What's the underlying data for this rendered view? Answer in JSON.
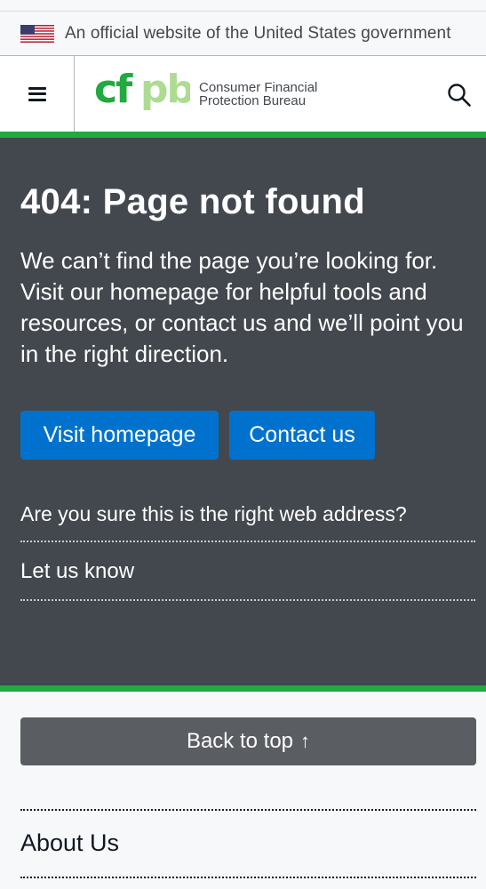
{
  "banner": {
    "text": "An official website of the United States government",
    "flag_icon": "us-flag-icon"
  },
  "header": {
    "menu_icon": "hamburger-menu-icon",
    "logo_mark": "cfpb",
    "logo_line1": "Consumer Financial",
    "logo_line2": "Protection Bureau",
    "search_icon": "search-icon"
  },
  "main": {
    "title": "404: Page not found",
    "body": "We can’t find the page you’re looking for. Visit our homepage for helpful tools and resources, or contact us and we’ll point you in the right direction.",
    "buttons": {
      "home": "Visit homepage",
      "contact": "Contact us"
    },
    "question": "Are you sure this is the right web address?",
    "let_us_know": "Let us know"
  },
  "footer": {
    "back_to_top": "Back to top",
    "back_to_top_icon": "arrow-up-icon",
    "back_to_top_glyph": "↑",
    "about_link": "About Us"
  },
  "colors": {
    "accent_green": "#20aa3f",
    "logo_light_green": "#addc91",
    "primary_blue": "#0072ce",
    "hero_bg": "#43484e",
    "back_top_bg": "#5a5d61"
  }
}
